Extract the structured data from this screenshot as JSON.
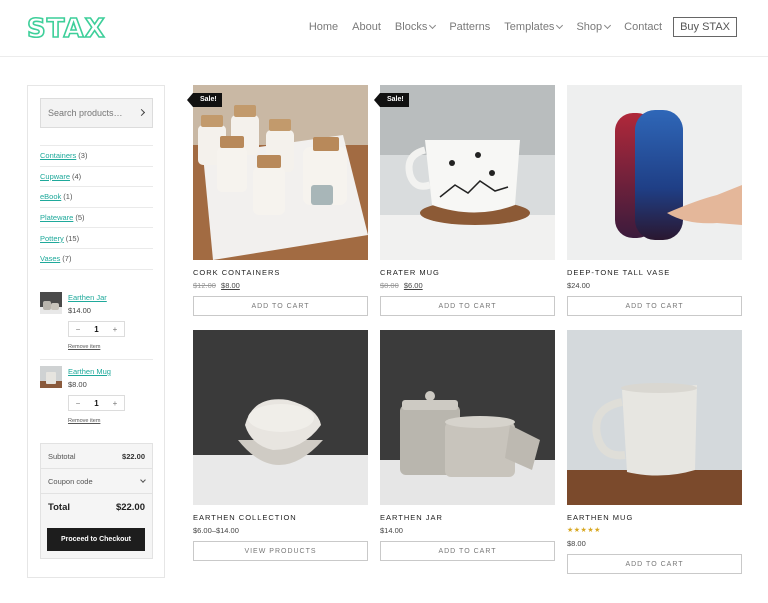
{
  "brand": {
    "logo": "STAX",
    "accent": "#3ecf9a",
    "link_color": "#1fa99b"
  },
  "nav": {
    "items": [
      {
        "label": "Home",
        "dropdown": false
      },
      {
        "label": "About",
        "dropdown": false
      },
      {
        "label": "Blocks",
        "dropdown": true
      },
      {
        "label": "Patterns",
        "dropdown": false
      },
      {
        "label": "Templates",
        "dropdown": true
      },
      {
        "label": "Shop",
        "dropdown": true
      },
      {
        "label": "Contact",
        "dropdown": false
      }
    ],
    "cta": "Buy STAX"
  },
  "sidebar": {
    "search": {
      "placeholder": "Search products…"
    },
    "categories": [
      {
        "name": "Containers",
        "count": "(3)"
      },
      {
        "name": "Cupware",
        "count": "(4)"
      },
      {
        "name": "eBook",
        "count": "(1)"
      },
      {
        "name": "Plateware",
        "count": "(5)"
      },
      {
        "name": "Pottery",
        "count": "(15)"
      },
      {
        "name": "Vases",
        "count": "(7)"
      }
    ],
    "cart": {
      "items": [
        {
          "name": "Earthen Jar",
          "price": "$14.00",
          "qty": "1",
          "minus": "−",
          "plus": "+",
          "remove": "Remove item"
        },
        {
          "name": "Earthen Mug",
          "price": "$8.00",
          "qty": "1",
          "minus": "−",
          "plus": "+",
          "remove": "Remove item"
        }
      ],
      "subtotal_label": "Subtotal",
      "subtotal": "$22.00",
      "coupon_label": "Coupon code",
      "total_label": "Total",
      "total": "$22.00",
      "checkout": "Proceed to Checkout"
    }
  },
  "products": [
    {
      "name": "Cork Containers",
      "old_price": "$12.00",
      "price": "$8.00",
      "sale": "Sale!",
      "button": "Add to cart"
    },
    {
      "name": "Crater Mug",
      "old_price": "$8.00",
      "price": "$6.00",
      "sale": "Sale!",
      "button": "Add to cart"
    },
    {
      "name": "Deep-tone Tall Vase",
      "price": "$24.00",
      "button": "Add to cart"
    },
    {
      "name": "Earthen Collection",
      "price": "$6.00–$14.00",
      "button": "View products"
    },
    {
      "name": "Earthen Jar",
      "price": "$14.00",
      "button": "Add to cart"
    },
    {
      "name": "Earthen Mug",
      "rating": "5 of 5 stars",
      "stars": "★★★★★",
      "price": "$8.00",
      "button": "Add to cart"
    }
  ]
}
